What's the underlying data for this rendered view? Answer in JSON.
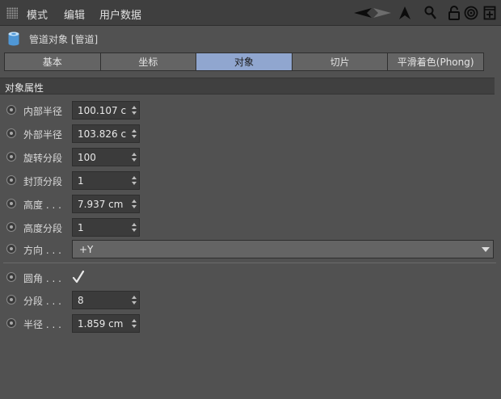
{
  "menubar": {
    "items": [
      "模式",
      "编辑",
      "用户数据"
    ]
  },
  "toolbar": {
    "icons": [
      "back-arrow-icon",
      "forward-arrow-icon",
      "cursor-up-icon",
      "search-icon",
      "lock-icon",
      "target-icon",
      "new-panel-icon"
    ]
  },
  "object": {
    "title": "管道对象 [管道]",
    "icon": "tube-icon"
  },
  "tabs": [
    {
      "label": "基本",
      "active": false
    },
    {
      "label": "坐标",
      "active": false
    },
    {
      "label": "对象",
      "active": true
    },
    {
      "label": "切片",
      "active": false
    },
    {
      "label": "平滑着色(Phong)",
      "active": false
    }
  ],
  "section": {
    "title": "对象属性"
  },
  "properties": {
    "inner_radius": {
      "label": "内部半径",
      "value": "100.107 c"
    },
    "outer_radius": {
      "label": "外部半径",
      "value": "103.826 c"
    },
    "rotation_segments": {
      "label": "旋转分段",
      "value": "100"
    },
    "cap_segments": {
      "label": "封顶分段",
      "value": "1"
    },
    "height": {
      "label": "高度 . . .",
      "value": "7.937 cm"
    },
    "height_segments": {
      "label": "高度分段",
      "value": "1"
    },
    "orientation": {
      "label": "方向 . . .",
      "value": "+Y"
    },
    "fillet": {
      "label": "圆角 . . .",
      "checked": true
    },
    "fillet_segments": {
      "label": "分段 . . .",
      "value": "8"
    },
    "fillet_radius": {
      "label": "半径 . . .",
      "value": "1.859 cm"
    }
  },
  "colors": {
    "background": "#515151",
    "active_tab": "#90a6cf",
    "field": "#3b3b3b"
  }
}
